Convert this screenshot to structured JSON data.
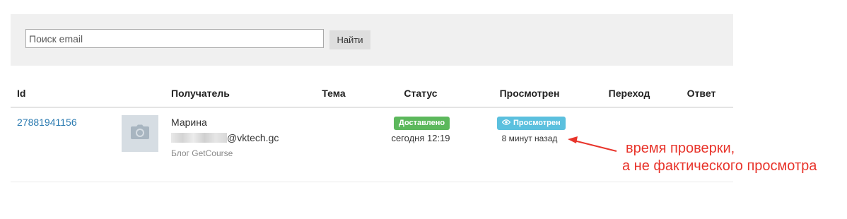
{
  "search": {
    "placeholder": "Поиск email",
    "button_label": "Найти"
  },
  "table": {
    "columns": {
      "id": "Id",
      "recipient": "Получатель",
      "subject": "Тема",
      "status": "Статус",
      "viewed": "Просмотрен",
      "click": "Переход",
      "reply": "Ответ"
    },
    "rows": [
      {
        "id": "27881941156",
        "avatar_icon": "camera-icon",
        "recipient_name": "Марина",
        "recipient_email_domain": "@vktech.gc",
        "recipient_source": "Блог GetCourse",
        "subject": "",
        "status_badge": "Доставлено",
        "status_time": "сегодня 12:19",
        "viewed_badge": "Просмотрен",
        "viewed_icon": "eye-icon",
        "viewed_time": "8 минут назад",
        "click": "",
        "reply": ""
      }
    ]
  },
  "annotation": {
    "line1": "время проверки,",
    "line2": "а не фактического просмотра",
    "color": "#e8342b"
  },
  "colors": {
    "link": "#2a7ab0",
    "badge_delivered": "#5cb85c",
    "badge_viewed": "#5bc0de",
    "panel_bg": "#f0f0f0"
  }
}
